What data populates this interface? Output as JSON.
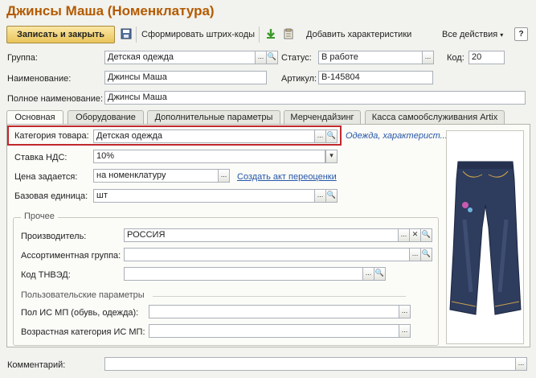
{
  "window": {
    "title": "Джинсы Маша (Номенклатура)"
  },
  "toolbar": {
    "save_close": "Записать и закрыть",
    "barcodes": "Сформировать штрих-коды",
    "add_chars": "Добавить характеристики",
    "all_actions": "Все действия",
    "help": "?"
  },
  "header": {
    "group_label": "Группа:",
    "group_value": "Детская одежда",
    "status_label": "Статус:",
    "status_value": "В работе",
    "code_label": "Код:",
    "code_value": "20",
    "name_label": "Наименование:",
    "name_value": "Джинсы Маша",
    "article_label": "Артикул:",
    "article_value": "В-145804",
    "fullname_label": "Полное наименование:",
    "fullname_value": "Джинсы Маша"
  },
  "tabs": [
    "Основная",
    "Оборудование",
    "Дополнительные параметры",
    "Мерчендайзинг",
    "Касса самообслуживания Artix"
  ],
  "main": {
    "category_label": "Категория товара:",
    "category_value": "Детская одежда",
    "category_link": "Одежда, характерист...",
    "vat_label": "Ставка НДС:",
    "vat_value": "10%",
    "price_label": "Цена задается:",
    "price_value": "на номенклатуру",
    "revaluation_link": "Создать акт переоценки",
    "unit_label": "Базовая единица:",
    "unit_value": "шт"
  },
  "other": {
    "legend": "Прочее",
    "manufacturer_label": "Производитель:",
    "manufacturer_value": "РОССИЯ",
    "assortment_label": "Ассортиментная группа:",
    "assortment_value": "",
    "tnved_label": "Код ТНВЭД:",
    "tnved_value": "",
    "user_params": "Пользовательские параметры",
    "gender_label": "Пол ИС МП (обувь, одежда):",
    "gender_value": "",
    "age_label": "Возрастная категория ИС МП:",
    "age_value": ""
  },
  "comment": {
    "label": "Комментарий:",
    "value": ""
  },
  "colors": {
    "title": "#b35a00",
    "highlight": "#c0282c",
    "link": "#2657a8",
    "button": "#e9c45a"
  }
}
